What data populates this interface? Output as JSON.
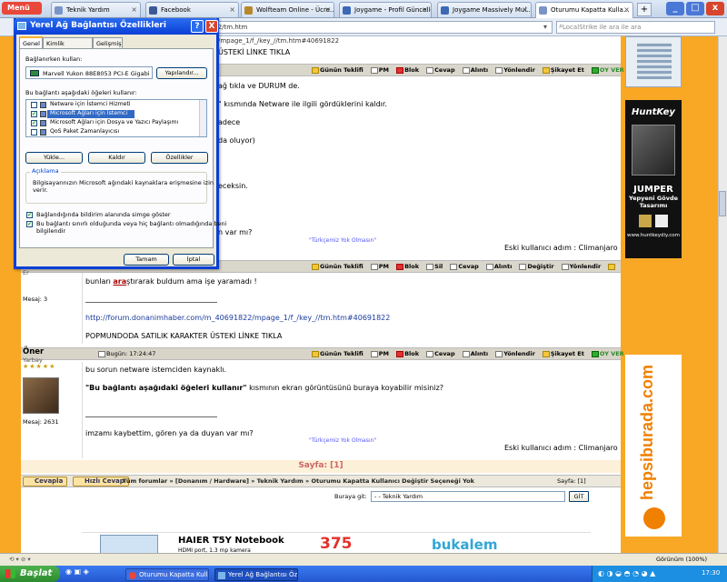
{
  "browser": {
    "menu_label": "Menü",
    "tabs": [
      {
        "label": "Teknik Yardım"
      },
      {
        "label": "Facebook"
      },
      {
        "label": "Wolfteam Online - Ücre..."
      },
      {
        "label": "Joygame - Profil Güncelle"
      },
      {
        "label": "Joygame Massively Mul..."
      },
      {
        "label": "Oturumu Kapatta Kulla..."
      }
    ],
    "new_tab": "+",
    "url": "7571822/tm.htm",
    "search_placeholder": "LocalStrike ile ara ile ara",
    "window_buttons": {
      "minimize": "_",
      "maximize": "□",
      "close": "x"
    }
  },
  "dialog": {
    "title": "Yerel Ağ Bağlantısı Özellikleri",
    "help_btn": "?",
    "close_btn": "X",
    "tabs": [
      "Genel",
      "Kimlik Doğrulama",
      "Gelişmiş"
    ],
    "connect_using_label": "Bağlanırken kullan:",
    "adapter_name": "Marvell Yukon 88E8053 PCI-E Gigabi",
    "configure_button": "Yapılandır...",
    "items_label": "Bu bağlantı aşağıdaki öğeleri kullanır:",
    "items": [
      {
        "label": "Netware için İstemci Hizmeti",
        "checked": false
      },
      {
        "label": "Microsoft Ağları için İstemci",
        "checked": true
      },
      {
        "label": "Microsoft Ağları için Dosya ve Yazıcı Paylaşımı",
        "checked": true
      },
      {
        "label": "QoS Paket Zamanlayıcısı",
        "checked": false
      }
    ],
    "install_button": "Yükle...",
    "uninstall_button": "Kaldır",
    "properties_button": "Özellikler",
    "description_legend": "Açıklama",
    "description_text_1": "Bilgisayarınızın Microsoft ağındaki kaynaklara erişmesine izin",
    "description_text_2": "verir.",
    "option_1": "Bağlandığında bildirim alanında simge göster",
    "option_2_line1": "Bu bağlantı sınırlı olduğunda veya hiç bağlantı olmadığında beni",
    "option_2_line2": "bilgilendir",
    "ok_button": "Tamam",
    "cancel_button": "İptal"
  },
  "forum": {
    "top_url_fragment": "/mpage_1/f_/key_//tm.htm#40691822",
    "top_sig_line": "ÜSTEKİ LİNKE TIKLA",
    "post1": {
      "actions": [
        "Günün Teklifi",
        "PM",
        "Blok",
        "Cevap",
        "Alıntı",
        "Yönlendir",
        "Şikayet Et",
        "OY VER"
      ],
      "lines": [
        "ağ tıkla ve DURUM de.",
        "\" kısmında Netware ile ilgili gördüklerini kaldır.",
        "adece",
        "da oluyor)",
        "ecek­sin.",
        "n var mı?"
      ],
      "signature": "\"Türkçemiz Yok Olmasın\"",
      "quote": "Eski kullanıcı adım : Climanjaro"
    },
    "post2": {
      "rank": "Er",
      "actions": [
        "Günün Teklifi",
        "PM",
        "Blok",
        "Sil",
        "Cevap",
        "Alıntı",
        "Değiştir",
        "Yönlendir"
      ],
      "messages": "Mesaj: 3",
      "text_pre": "bunları ",
      "text_highlight": "ara",
      "text_post": "ştırarak buldum ama işe yaramadı !",
      "link": "http://forum.donanimhaber.com/m_40691822/mpage_1/f_/key_//tm.htm#40691822",
      "sig": "POPMUNDODA SATILIK KARAKTER ÜSTEKİ LİNKE TIKLA"
    },
    "post3": {
      "username": "Öner",
      "rank": "Yarbay",
      "stars": "★★★★★",
      "time": "Bugün: 17:24:47",
      "actions": [
        "Günün Teklifi",
        "PM",
        "Blok",
        "Cevap",
        "Alıntı",
        "Yönlendir",
        "Şikayet Et",
        "OY VER"
      ],
      "messages": "Mesaj: 2631",
      "line1": "bu sorun netware istemciden kaynaklı.",
      "quote_bold": "\"Bu bağlantı aşağıdaki öğeleri kullanır\"",
      "quote_rest": " kısmının ekran görüntüsünü buraya koyabilir misiniz?",
      "line3": "imzamı kaybettim, gören ya da duyan var mı?",
      "signature": "\"Türkçemiz Yok Olmasın\"",
      "old_name": "Eski kullanıcı adım : Climanjaro"
    },
    "pagination": "Sayfa:  [1]",
    "reply_button": "Cevapla",
    "quick_reply_button": "Hızlı Cevap",
    "breadcrumb": "Tüm forumlar » [Donanım / Hardware] » Teknik Yardım » Oturumu Kapatta Kullanıcı Değiştir Seçeneği Yok",
    "page_indicator": "Sayfa: [1]",
    "goto_label": "Buraya git:",
    "goto_value": "- - Teknik Yardım",
    "goto_button": "GİT",
    "bottom_ad": {
      "title": "HAIER T5Y Notebook",
      "sub": "HDMI port, 1.3 mp kamera",
      "price": "375",
      "brand": "bukalem"
    }
  },
  "ads": {
    "huntkey_logo": "HuntKey",
    "huntkey_line1": "JUMPER",
    "huntkey_line2": "Yepyeni Gövde",
    "huntkey_line3": "Tasarımı",
    "huntkey_url": "www.huntkeydiy.com",
    "hepsiburada": "hepsiburada.com"
  },
  "statusbar": {
    "zoom": "Görünüm (100%)"
  },
  "taskbar": {
    "start": "Başlat",
    "tasks": [
      "Oturumu Kapatta Kull...",
      "Yerel Ağ Bağlantısı Öz..."
    ],
    "clock": "17:30"
  },
  "colors": {
    "page_bg": "#f9a825",
    "title_blue": "#0a3fd6",
    "taskbar": "#2457d0"
  }
}
